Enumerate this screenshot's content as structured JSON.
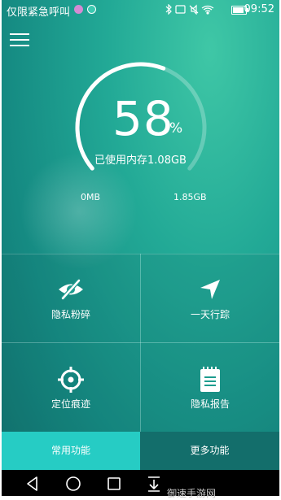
{
  "status_bar": {
    "carrier": "仅限紧急呼叫",
    "icons": [
      "bluetooth-icon",
      "nfc-icon",
      "mute-icon",
      "wifi-icon",
      "battery-icon"
    ],
    "time": "09:52"
  },
  "gauge": {
    "percent": "58",
    "percent_sign": "%",
    "usage_fraction": 0.58,
    "used_label": "已使用内存1.08GB",
    "min_label": "0MB",
    "max_label": "1.85GB"
  },
  "grid": {
    "items": [
      {
        "label": "隐私粉碎",
        "icon": "eye-slash-icon"
      },
      {
        "label": "一天行踪",
        "icon": "navigation-arrow-icon"
      },
      {
        "label": "定位痕迹",
        "icon": "crosshair-icon"
      },
      {
        "label": "隐私报告",
        "icon": "notepad-icon"
      }
    ]
  },
  "tabs": {
    "common": "常用功能",
    "more": "更多功能"
  },
  "watermark": "御速手游网",
  "colors": {
    "accent": "#26ccc4",
    "background_top": "#3fc7a6",
    "background_bottom": "#116f6c",
    "tab_inactive": "#136e6b"
  }
}
